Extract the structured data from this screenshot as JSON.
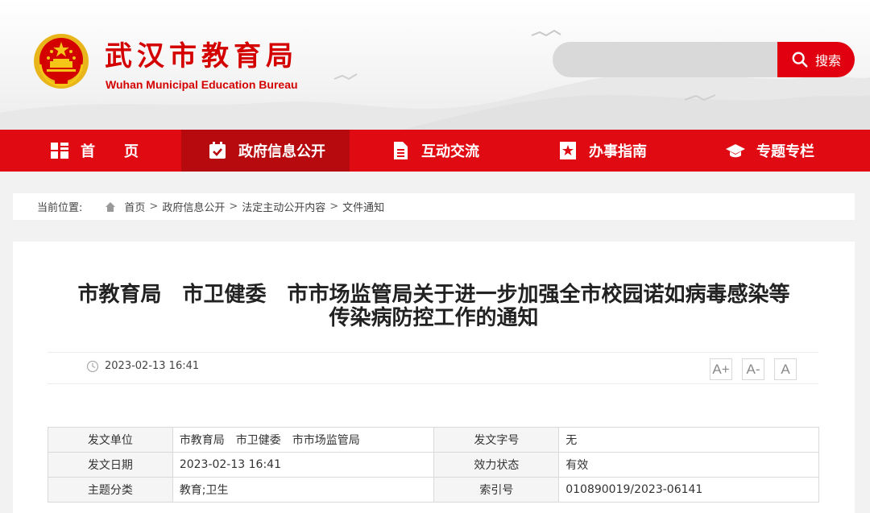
{
  "header": {
    "title": "武汉市教育局",
    "subtitle": "Wuhan Municipal Education Bureau",
    "search": {
      "placeholder": "",
      "button_label": "搜索"
    }
  },
  "nav": {
    "items": [
      {
        "label": "首　　页",
        "icon": "home-grid-icon"
      },
      {
        "label": "政府信息公开",
        "icon": "calendar-check-icon",
        "active": true
      },
      {
        "label": "互动交流",
        "icon": "document-icon"
      },
      {
        "label": "办事指南",
        "icon": "bookmark-star-icon"
      },
      {
        "label": "专题专栏",
        "icon": "graduation-cap-icon"
      }
    ]
  },
  "breadcrumb": {
    "label": "当前位置:",
    "items": [
      "首页",
      "政府信息公开",
      "法定主动公开内容",
      "文件通知"
    ],
    "separator": ">"
  },
  "article": {
    "title": "市教育局　市卫健委　市市场监管局关于进一步加强全市校园诺如病毒感染等\n传染病防控工作的通知",
    "date": "2023-02-13 16:41",
    "font_controls": [
      "A+",
      "A-",
      "A"
    ]
  },
  "info_table": {
    "rows": [
      [
        "发文单位",
        "市教育局　市卫健委　市市场监管局",
        "发文字号",
        "无"
      ],
      [
        "发文日期",
        "2023-02-13 16:41",
        "效力状态",
        "有效"
      ],
      [
        "主题分类",
        "教育;卫生",
        "索引号",
        "010890019/2023-06141"
      ]
    ]
  },
  "colors": {
    "brand_red": "#e00a12",
    "active_nav": "#b70a0e",
    "title_red": "#d40000"
  }
}
